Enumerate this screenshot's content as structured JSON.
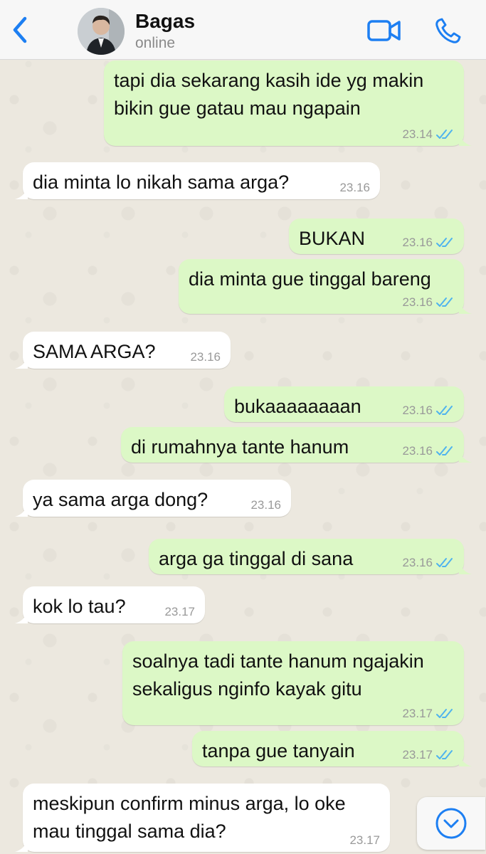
{
  "header": {
    "name": "Bagas",
    "status": "online"
  },
  "colors": {
    "accent": "#1d7ff2",
    "outgoing_bubble": "#dcf8c6",
    "incoming_bubble": "#ffffff",
    "read_tick": "#4fb3ee"
  },
  "icons": {
    "back": "chevron-left-icon",
    "video": "video-camera-icon",
    "phone": "phone-icon",
    "read": "double-check-icon",
    "scroll": "chevron-down-circle-icon"
  },
  "messages": [
    {
      "dir": "out",
      "text": "tapi dia sekarang kasih ide yg makin\nbikin gue gatau mau ngapain",
      "time": "23.14",
      "read": true
    },
    {
      "dir": "in",
      "text": "dia minta lo nikah sama arga?",
      "time": "23.16"
    },
    {
      "dir": "out",
      "text": "BUKAN",
      "time": "23.16",
      "read": true
    },
    {
      "dir": "out",
      "text": "dia minta gue tinggal bareng",
      "time": "23.16",
      "read": true
    },
    {
      "dir": "in",
      "text": "SAMA ARGA?",
      "time": "23.16"
    },
    {
      "dir": "out",
      "text": "bukaaaaaaaan",
      "time": "23.16",
      "read": true
    },
    {
      "dir": "out",
      "text": "di rumahnya tante hanum",
      "time": "23.16",
      "read": true
    },
    {
      "dir": "in",
      "text": "ya sama arga dong?",
      "time": "23.16"
    },
    {
      "dir": "out",
      "text": "arga ga tinggal di sana",
      "time": "23.16",
      "read": true
    },
    {
      "dir": "in",
      "text": "kok lo tau?",
      "time": "23.17"
    },
    {
      "dir": "out",
      "text": "soalnya tadi tante hanum ngajakin\nsekaligus nginfo kayak gitu",
      "time": "23.17",
      "read": true
    },
    {
      "dir": "out",
      "text": "tanpa gue tanyain",
      "time": "23.17",
      "read": true
    },
    {
      "dir": "in",
      "text": "meskipun confirm minus arga, lo oke\nmau tinggal sama dia?",
      "time": "23.17"
    }
  ]
}
